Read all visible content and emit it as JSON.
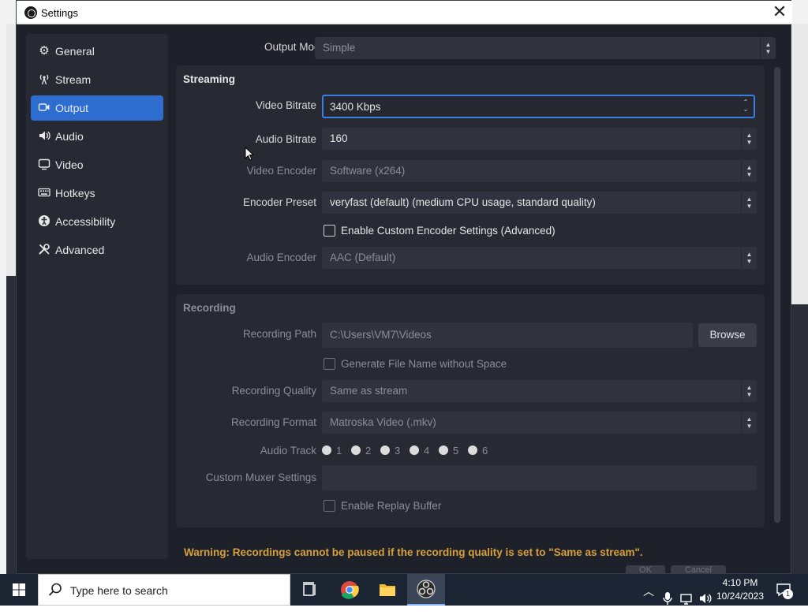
{
  "window": {
    "title": "Settings",
    "close_glyph": "✕"
  },
  "sidebar": {
    "items": [
      {
        "label": "General",
        "icon": "gear-icon",
        "glyph": "⚙"
      },
      {
        "label": "Stream",
        "icon": "broadcast-icon",
        "glyph": "📡"
      },
      {
        "label": "Output",
        "icon": "output-icon",
        "glyph": "⏻"
      },
      {
        "label": "Audio",
        "icon": "speaker-icon",
        "glyph": "🔊"
      },
      {
        "label": "Video",
        "icon": "monitor-icon",
        "glyph": "▭"
      },
      {
        "label": "Hotkeys",
        "icon": "keyboard-icon",
        "glyph": "⌨"
      },
      {
        "label": "Accessibility",
        "icon": "accessibility-icon",
        "glyph": "♿"
      },
      {
        "label": "Advanced",
        "icon": "tools-icon",
        "glyph": "✂"
      }
    ],
    "active_index": 2
  },
  "output": {
    "mode_label": "Output Mode",
    "mode_value": "Simple",
    "streaming": {
      "title": "Streaming",
      "video_bitrate_label": "Video Bitrate",
      "video_bitrate_value": "3400 Kbps",
      "audio_bitrate_label": "Audio Bitrate",
      "audio_bitrate_value": "160",
      "video_encoder_label": "Video Encoder",
      "video_encoder_value": "Software (x264)",
      "encoder_preset_label": "Encoder Preset",
      "encoder_preset_value": "veryfast (default) (medium CPU usage, standard quality)",
      "custom_encoder_label": "Enable Custom Encoder Settings (Advanced)",
      "audio_encoder_label": "Audio Encoder",
      "audio_encoder_value": "AAC (Default)"
    },
    "recording": {
      "title": "Recording",
      "path_label": "Recording Path",
      "path_value": "C:\\Users\\VM7\\Videos",
      "browse_label": "Browse",
      "no_space_label": "Generate File Name without Space",
      "quality_label": "Recording Quality",
      "quality_value": "Same as stream",
      "format_label": "Recording Format",
      "format_value": "Matroska Video (.mkv)",
      "audio_track_label": "Audio Track",
      "tracks": [
        "1",
        "2",
        "3",
        "4",
        "5",
        "6"
      ],
      "muxer_label": "Custom Muxer Settings",
      "muxer_value": "",
      "replay_label": "Enable Replay Buffer"
    },
    "warning": "Warning: Recordings cannot be paused if the recording quality is set to \"Same as stream\"."
  },
  "dialog_buttons": {
    "ok": "OK",
    "cancel": "Cancel"
  },
  "taskbar": {
    "search_placeholder": "Type here to search",
    "time": "4:10 PM",
    "date": "10/24/2023",
    "notification_count": "1"
  },
  "colors": {
    "accent": "#2e6dd0",
    "warning": "#d6a03a",
    "panel": "#272a33",
    "window_bg": "#1f212a"
  }
}
